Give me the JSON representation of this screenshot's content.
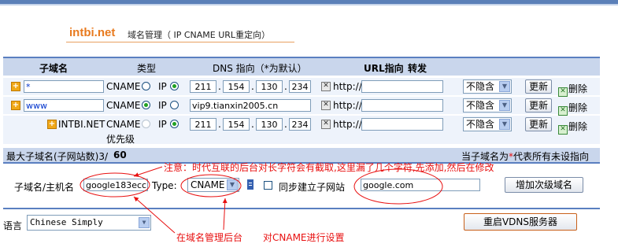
{
  "header": {
    "brand": "intbi.net",
    "subtitle": "域名管理（ IP CNAME URL重定向）"
  },
  "table": {
    "columns": {
      "subdomain": "子域名",
      "type": "类型",
      "dns": "DNS 指向（*为默认）",
      "url": "URL指向",
      "forward": "转发"
    },
    "type_cname": "CNAME",
    "type_ip": "IP",
    "url_prefix": "http://",
    "update_label": "更新",
    "delete_label": "删除",
    "rows": [
      {
        "name": "*",
        "type_selected": "IP",
        "ip": [
          "211",
          "154",
          "130",
          "234"
        ],
        "url": "",
        "hide": "不隐含"
      },
      {
        "name": "www",
        "type_selected": "CNAME",
        "cname": "vip9.tianxin2005.cn",
        "url": "",
        "hide": "不隐含"
      },
      {
        "name": "INTBI.NET",
        "type_selected": "IP",
        "ip": [
          "211",
          "154",
          "130",
          "234"
        ],
        "url": "",
        "hide": "不隐含",
        "note": "优先级"
      }
    ]
  },
  "status": {
    "max_label": "最大子域名(子网站数)3/",
    "max_value": "60",
    "hint_pre": "当子域名为",
    "hint_star": "*",
    "hint_post": "代表所有未设指向"
  },
  "addform": {
    "label": "子域名/主机名",
    "subdomain_value": "google183ecc",
    "type_label": "Type:",
    "type_value": "CNAME",
    "sync_label": "同步建立子网站",
    "target_value": "google.com",
    "add_button": "增加次级域名"
  },
  "footer": {
    "lang_label": "语言",
    "lang_value": "Chinese Simply",
    "restart_button": "重启VDNS服务器"
  },
  "annotations": {
    "note_top": "注意：时代互联的后台对长字符会有截取,这里漏了几个字符,先添加,然后在修改",
    "note_left": "在域名管理后台",
    "note_right": "对CNAME进行设置",
    "color": "#e81010"
  },
  "colors": {
    "accent": "#e87a1e",
    "header_bg": "#c9d6ec",
    "row_bg": "#eef3fb",
    "border": "#5a7fc0"
  }
}
